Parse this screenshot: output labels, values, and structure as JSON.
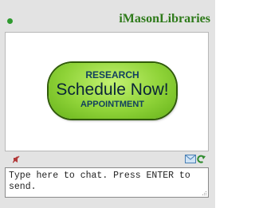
{
  "widget": {
    "title": "iMasonLibraries",
    "status": "online",
    "colors": {
      "title": "#2e7a1a",
      "status_dot": "#2f9a2f",
      "button_green": "#8fd338",
      "button_text": "#12405e"
    }
  },
  "banner": {
    "line_top": "RESEARCH",
    "line_main": "Schedule Now!",
    "line_bottom": "APPOINTMENT"
  },
  "toolbar": {
    "icons": [
      "mute-icon",
      "mail-icon",
      "refresh-icon"
    ]
  },
  "chat": {
    "placeholder": "Type here to chat. Press ENTER to send.",
    "value": ""
  }
}
